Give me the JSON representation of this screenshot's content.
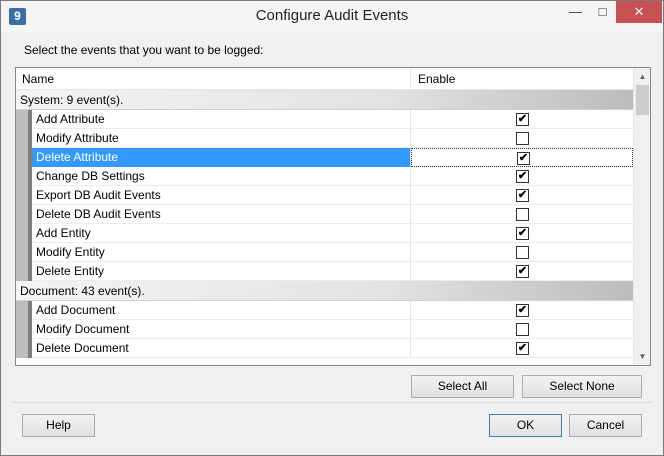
{
  "window": {
    "title": "Configure Audit Events",
    "icon_glyph": "9"
  },
  "titlebar_buttons": {
    "minimize": "—",
    "maximize": "□",
    "close": "✕"
  },
  "prompt": "Select the events that you want to be logged:",
  "columns": {
    "name": "Name",
    "enable": "Enable"
  },
  "groups": [
    {
      "label": "System: 9 event(s).",
      "items": [
        {
          "name": "Add Attribute",
          "enabled": true
        },
        {
          "name": "Modify Attribute",
          "enabled": false
        },
        {
          "name": "Delete Attribute",
          "enabled": true,
          "selected": true
        },
        {
          "name": "Change DB Settings",
          "enabled": true
        },
        {
          "name": "Export DB Audit Events",
          "enabled": true
        },
        {
          "name": "Delete DB Audit Events",
          "enabled": false
        },
        {
          "name": "Add Entity",
          "enabled": true
        },
        {
          "name": "Modify Entity",
          "enabled": false
        },
        {
          "name": "Delete Entity",
          "enabled": true
        }
      ]
    },
    {
      "label": "Document: 43 event(s).",
      "items": [
        {
          "name": "Add Document",
          "enabled": true
        },
        {
          "name": "Modify Document",
          "enabled": false
        },
        {
          "name": "Delete Document",
          "enabled": true
        }
      ]
    }
  ],
  "buttons": {
    "select_all": "Select All",
    "select_none": "Select None",
    "help": "Help",
    "ok": "OK",
    "cancel": "Cancel"
  },
  "check_glyph": "✔"
}
